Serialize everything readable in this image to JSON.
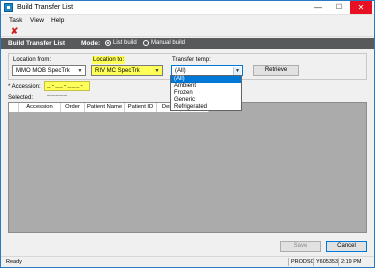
{
  "window": {
    "title": "Build Transfer List",
    "minimize_glyph": "—",
    "maximize_glyph": "☐",
    "close_glyph": "✕"
  },
  "menu": {
    "items": [
      "Task",
      "View",
      "Help"
    ]
  },
  "toolbar": {
    "cancel_icon": "close-x-icon",
    "cancel_glyph": "✘",
    "cancel_color": "#d3201c"
  },
  "header": {
    "title": "Build Transfer List",
    "mode_label": "Mode:",
    "modes": [
      {
        "label": "List build",
        "selected": true
      },
      {
        "label": "Manual build",
        "selected": false
      }
    ]
  },
  "filters": {
    "location_from_label": "Location from:",
    "location_from_value": "MMO MOB SpecTrk",
    "location_to_label": "Location to:",
    "location_to_value": "RIV MC SpecTrk",
    "transfer_temp_label": "Transfer temp:",
    "transfer_temp_value": "(All)",
    "retrieve_label": "Retrieve",
    "highlight_color": "#ffff5a"
  },
  "dropdown": {
    "options": [
      "(All)",
      "Ambient",
      "Frozen",
      "Generic",
      "Refrigerated"
    ],
    "selected_index": 0
  },
  "accession": {
    "label": "* Accession:",
    "value": "_-__-___-_____"
  },
  "selected": {
    "label": "Selected:",
    "columns": [
      "",
      "Accession",
      "Order",
      "Patient Name",
      "Patient ID",
      "Desc",
      ""
    ]
  },
  "buttons": {
    "save": "Save",
    "cancel": "Cancel"
  },
  "statusbar": {
    "status": "Ready",
    "user": "PRODSC",
    "terminal": "Y605353",
    "time": "2:19 PM"
  }
}
